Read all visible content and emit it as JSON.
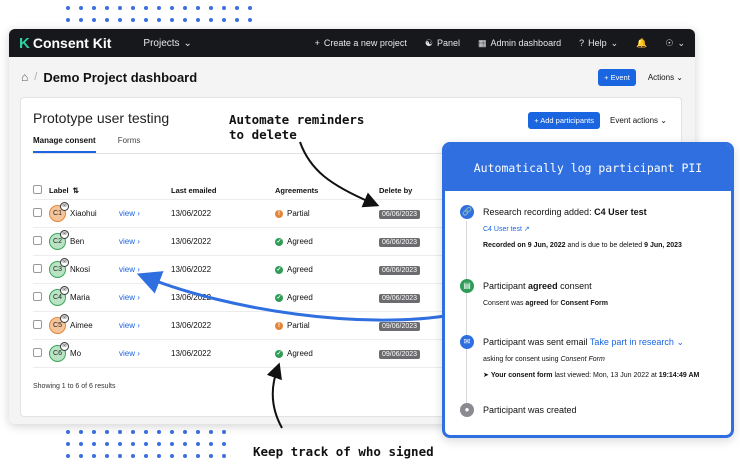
{
  "app": {
    "logo_text": "Consent Kit",
    "nav": {
      "projects": "Projects",
      "create_project": "Create a new project",
      "panel": "Panel",
      "admin_dashboard": "Admin dashboard",
      "help": "Help"
    },
    "breadcrumb_title": "Demo Project dashboard",
    "event_button": "+ Event",
    "actions": "Actions"
  },
  "card": {
    "title": "Prototype user testing",
    "tabs": [
      "Manage consent",
      "Forms"
    ],
    "add_participants": "+ Add participants",
    "event_actions": "Event actions",
    "columns": [
      "Label",
      "Last emailed",
      "Agreements",
      "Delete by"
    ],
    "rows": [
      {
        "id": "C1",
        "name": "Xiaohui",
        "view": "view",
        "last_emailed": "13/06/2022",
        "agreement": "Partial",
        "delete_by": "06/06/2023",
        "avatar_color": "#e48638"
      },
      {
        "id": "C2",
        "name": "Ben",
        "view": "view",
        "last_emailed": "13/06/2022",
        "agreement": "Agreed",
        "delete_by": "06/06/2023",
        "avatar_color": "#3aa55c"
      },
      {
        "id": "C3",
        "name": "Nkosi",
        "view": "view",
        "last_emailed": "13/06/2022",
        "agreement": "Agreed",
        "delete_by": "06/06/2023",
        "avatar_color": "#3aa55c"
      },
      {
        "id": "C4",
        "name": "Maria",
        "view": "view",
        "last_emailed": "13/06/2022",
        "agreement": "Agreed",
        "delete_by": "09/06/2023",
        "avatar_color": "#3aa55c"
      },
      {
        "id": "C5",
        "name": "Aimee",
        "view": "view",
        "last_emailed": "13/06/2022",
        "agreement": "Partial",
        "delete_by": "09/06/2023",
        "avatar_color": "#e48638"
      },
      {
        "id": "C6",
        "name": "Mo",
        "view": "view",
        "last_emailed": "13/06/2022",
        "agreement": "Agreed",
        "delete_by": "09/06/2023",
        "avatar_color": "#3aa55c"
      }
    ],
    "showing": "Showing 1 to 6 of 6 results"
  },
  "log": {
    "header": "Automatically log participant PII",
    "item1": {
      "title_prefix": "Research recording added:",
      "title_bold": "C4 User test",
      "link": "C4 User test",
      "recorded_prefix": "Recorded on",
      "recorded_date": "9 Jun, 2022",
      "recorded_mid": "and is due to be deleted",
      "delete_date": "9 Jun, 2023"
    },
    "item2": {
      "title_prefix": "Participant",
      "title_bold": "agreed",
      "title_suffix": "consent",
      "sub_prefix": "Consent was",
      "sub_bold": "agreed",
      "sub_mid": "for",
      "sub_form": "Consent Form"
    },
    "item3": {
      "title": "Participant was sent email",
      "link": "Take part in research",
      "sub_prefix": "asking for consent using",
      "sub_form": "Consent Form",
      "viewed_bold": "Your consent form",
      "viewed_mid": "last viewed: Mon, 13 Jun 2022 at",
      "viewed_time": "19:14:49 AM"
    },
    "item4": {
      "title": "Participant was created"
    }
  },
  "annotations": {
    "reminders_line1": "Automate reminders",
    "reminders_line2": "to delete",
    "keep_track": "Keep track of who signed"
  },
  "colors": {
    "accent": "#1a66e0",
    "panel_blue": "#2f6fe0",
    "partial": "#e48638",
    "agreed": "#2f9d57",
    "topbar": "#17181c"
  }
}
